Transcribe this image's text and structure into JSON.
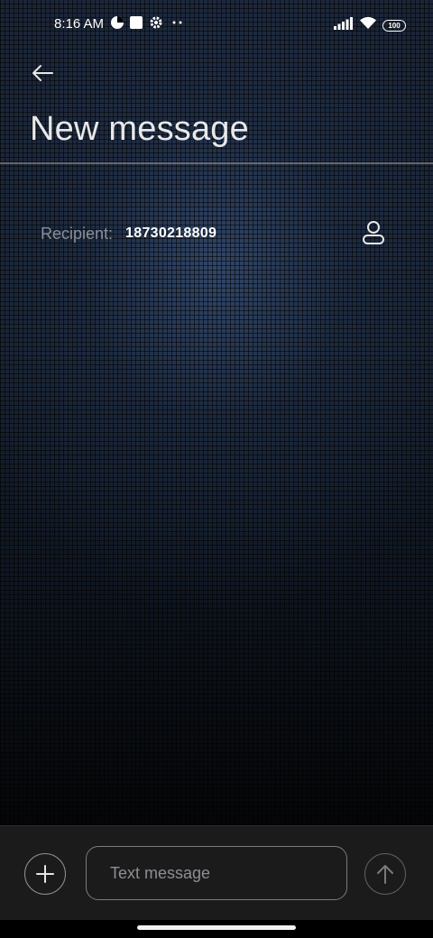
{
  "status_bar": {
    "time": "8:16 AM",
    "battery": "100",
    "icons": [
      "app-notification-icon",
      "square-notification-icon",
      "settings-icon",
      "more-dots-icon",
      "signal-icon",
      "wifi-icon",
      "battery-icon"
    ]
  },
  "header": {
    "back_icon": "arrow-left-icon",
    "title": "New message"
  },
  "recipient": {
    "label": "Recipient:",
    "value": "18730218809",
    "contact_icon": "person-icon"
  },
  "composer": {
    "add_icon": "plus-icon",
    "placeholder": "Text message",
    "value": "",
    "send_icon": "arrow-up-icon"
  },
  "colors": {
    "title": "#e8e8e8",
    "recipient_label": "#8a8f98",
    "composer_bg": "#1b1b1c"
  }
}
